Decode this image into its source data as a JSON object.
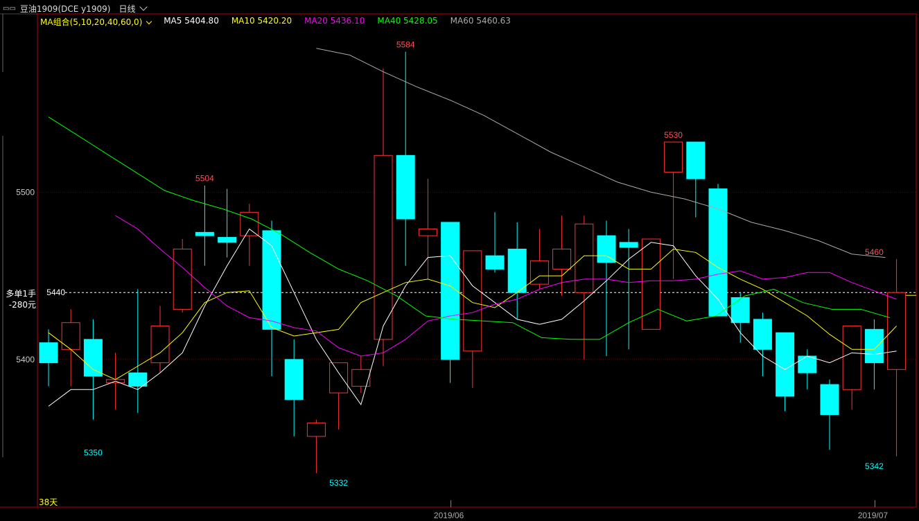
{
  "header": {
    "symbol_tag": "▭▭",
    "symbol": "豆油1909(DCE y1909)",
    "period": "日线",
    "period_chevron": "chevron-down-icon"
  },
  "ma": {
    "group_label": "MA组合(5,10,20,40,60,0)",
    "group_chevron": "chevron-down-icon",
    "items": [
      {
        "label": "MA5 5404.80",
        "color": "#ffffff"
      },
      {
        "label": "MA10 5420.20",
        "color": "#ffff00"
      },
      {
        "label": "MA20 5436.10",
        "color": "#ff00ff"
      },
      {
        "label": "MA40 5428.05",
        "color": "#00ff00"
      },
      {
        "label": "MA60 5460.63",
        "color": "#aaaaaa"
      }
    ]
  },
  "position": {
    "line1": "多单1手",
    "line2": "-280元"
  },
  "days_label": "38天",
  "chart_data": {
    "type": "candlestick",
    "colors": {
      "up": "#ff3232",
      "down": "#00ffff",
      "border": "#b40000",
      "grid": "#780000"
    },
    "y_ticks": [
      5400,
      5500
    ],
    "ylim": [
      5315,
      5600
    ],
    "price_line": {
      "value": 5440,
      "label": "5440"
    },
    "x_labels": [
      {
        "index": 18,
        "text": "2019/06"
      },
      {
        "index": 37,
        "text": "2019/07"
      }
    ],
    "annotations": [
      {
        "index": 7,
        "price": 5504,
        "text": "5504",
        "color": "#ff5050",
        "pos": "above"
      },
      {
        "index": 16,
        "price": 5584,
        "text": "5584",
        "color": "#ff5050",
        "pos": "above"
      },
      {
        "index": 28,
        "price": 5530,
        "text": "5530",
        "color": "#ff5050",
        "pos": "above"
      },
      {
        "index": 37,
        "price": 5460,
        "text": "5460",
        "color": "#ff5050",
        "pos": "above"
      },
      {
        "index": 2,
        "price": 5350,
        "text": "5350",
        "color": "#00ffff",
        "pos": "below"
      },
      {
        "index": 13,
        "price": 5332,
        "text": "5332",
        "color": "#00ffff",
        "pos": "below"
      },
      {
        "index": 37,
        "price": 5342,
        "text": "5342",
        "color": "#00ffff",
        "pos": "below"
      }
    ],
    "candles": [
      {
        "o": 5410,
        "h": 5418,
        "l": 5384,
        "c": 5398
      },
      {
        "o": 5406,
        "h": 5430,
        "l": 5384,
        "c": 5422
      },
      {
        "o": 5412,
        "h": 5424,
        "l": 5364,
        "c": 5390
      },
      {
        "o": 5386,
        "h": 5404,
        "l": 5370,
        "c": 5388
      },
      {
        "o": 5392,
        "h": 5442,
        "l": 5368,
        "c": 5384
      },
      {
        "o": 5398,
        "h": 5432,
        "l": 5392,
        "c": 5420
      },
      {
        "o": 5430,
        "h": 5472,
        "l": 5428,
        "c": 5466
      },
      {
        "o": 5476,
        "h": 5504,
        "l": 5456,
        "c": 5474
      },
      {
        "o": 5473,
        "h": 5502,
        "l": 5461,
        "c": 5470
      },
      {
        "o": 5474,
        "h": 5493,
        "l": 5456,
        "c": 5488
      },
      {
        "o": 5477,
        "h": 5483,
        "l": 5390,
        "c": 5418
      },
      {
        "o": 5400,
        "h": 5412,
        "l": 5354,
        "c": 5376
      },
      {
        "o": 5354,
        "h": 5364,
        "l": 5332,
        "c": 5362
      },
      {
        "o": 5380,
        "h": 5384,
        "l": 5358,
        "c": 5398
      },
      {
        "o": 5384,
        "h": 5402,
        "l": 5380,
        "c": 5394
      },
      {
        "o": 5412,
        "h": 5574,
        "l": 5396,
        "c": 5522
      },
      {
        "o": 5522,
        "h": 5584,
        "l": 5456,
        "c": 5484
      },
      {
        "o": 5474,
        "h": 5508,
        "l": 5448,
        "c": 5478
      },
      {
        "o": 5482,
        "h": 5476,
        "l": 5386,
        "c": 5400
      },
      {
        "o": 5405,
        "h": 5456,
        "l": 5383,
        "c": 5465
      },
      {
        "o": 5462,
        "h": 5488,
        "l": 5452,
        "c": 5454
      },
      {
        "o": 5466,
        "h": 5482,
        "l": 5424,
        "c": 5440
      },
      {
        "o": 5445,
        "h": 5478,
        "l": 5442,
        "c": 5459
      },
      {
        "o": 5454,
        "h": 5486,
        "l": 5438,
        "c": 5466
      },
      {
        "o": 5440,
        "h": 5486,
        "l": 5400,
        "c": 5481
      },
      {
        "o": 5474,
        "h": 5483,
        "l": 5402,
        "c": 5458
      },
      {
        "o": 5470,
        "h": 5478,
        "l": 5406,
        "c": 5467
      },
      {
        "o": 5418,
        "h": 5456,
        "l": 5422,
        "c": 5472
      },
      {
        "o": 5512,
        "h": 5524,
        "l": 5448,
        "c": 5530
      },
      {
        "o": 5530,
        "h": 5528,
        "l": 5485,
        "c": 5508
      },
      {
        "o": 5502,
        "h": 5505,
        "l": 5430,
        "c": 5426
      },
      {
        "o": 5437,
        "h": 5440,
        "l": 5410,
        "c": 5422
      },
      {
        "o": 5424,
        "h": 5428,
        "l": 5390,
        "c": 5406
      },
      {
        "o": 5416,
        "h": 5412,
        "l": 5369,
        "c": 5378
      },
      {
        "o": 5402,
        "h": 5406,
        "l": 5382,
        "c": 5392
      },
      {
        "o": 5385,
        "h": 5388,
        "l": 5346,
        "c": 5367
      },
      {
        "o": 5382,
        "h": 5420,
        "l": 5370,
        "c": 5420
      },
      {
        "o": 5418,
        "h": 5424,
        "l": 5382,
        "c": 5398
      },
      {
        "o": 5394,
        "h": 5460,
        "l": 5342,
        "c": 5440
      }
    ],
    "ma_series": [
      {
        "name": "MA5",
        "color": "#ffffff",
        "values": [
          5372,
          5382,
          5382,
          5387,
          5382,
          5392,
          5404,
          5432,
          5456,
          5478,
          5468,
          5440,
          5412,
          5392,
          5373,
          5420,
          5444,
          5461,
          5462,
          5444,
          5434,
          5424,
          5421,
          5424,
          5435,
          5447,
          5460,
          5470,
          5468,
          5450,
          5436,
          5416,
          5402,
          5394,
          5402,
          5398,
          5404,
          5403,
          5405
        ],
        "start": 0
      },
      {
        "name": "MA10",
        "color": "#ffff00",
        "values": [
          5416,
          5406,
          5394,
          5388,
          5396,
          5404,
          5416,
          5434,
          5440,
          5441,
          5419,
          5414,
          5416,
          5418,
          5434,
          5440,
          5446,
          5448,
          5444,
          5434,
          5431,
          5440,
          5450,
          5450,
          5462,
          5462,
          5454,
          5454,
          5466,
          5464,
          5455,
          5448,
          5442,
          5434,
          5426,
          5415,
          5406,
          5406,
          5420
        ],
        "start": 0
      },
      {
        "name": "MA20",
        "color": "#ff00ff",
        "values": [
          5486,
          5478,
          5466,
          5455,
          5443,
          5432,
          5425,
          5423,
          5419,
          5417,
          5407,
          5402,
          5404,
          5412,
          5423,
          5426,
          5428,
          5433,
          5436,
          5442,
          5446,
          5448,
          5448,
          5446,
          5447,
          5447,
          5448,
          5451,
          5453,
          5448,
          5449,
          5452,
          5452,
          5446,
          5441,
          5436
        ],
        "start": 3
      },
      {
        "name": "MA40",
        "color": "#00ff00",
        "values": [
          5545,
          5534,
          5523,
          5512,
          5501,
          5495,
          5490,
          5484,
          5475,
          5464,
          5454,
          5447,
          5438,
          5426,
          5424,
          5423,
          5422,
          5413,
          5412,
          5412,
          5422,
          5430,
          5423,
          5426,
          5438,
          5442,
          5434,
          5430,
          5430,
          5425
        ],
        "start": 0,
        "x_step": 1.3
      },
      {
        "name": "MA60",
        "color": "#aaaaaa",
        "values": [
          5586,
          5582,
          5572,
          5563,
          5555,
          5546,
          5535,
          5524,
          5515,
          5506,
          5500,
          5496,
          5490,
          5482,
          5477,
          5471,
          5463,
          5461
        ],
        "start": 12,
        "x_step": 1.5
      }
    ]
  }
}
